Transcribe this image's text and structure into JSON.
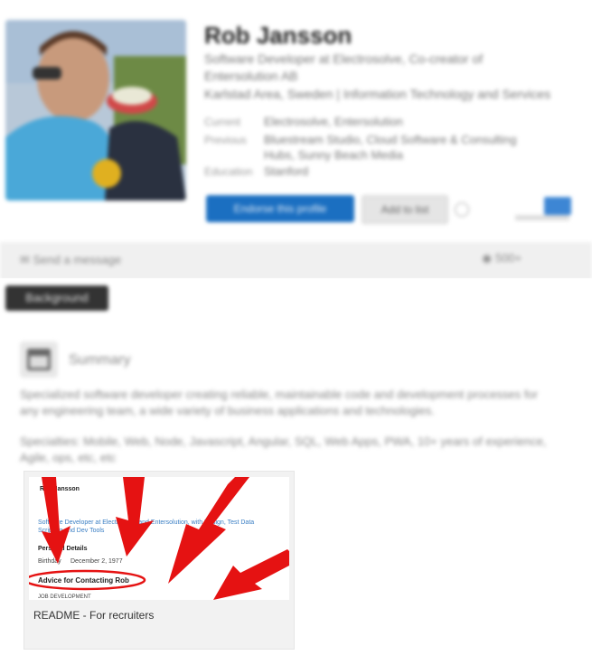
{
  "profile": {
    "name": "Rob Jansson",
    "headline_line1": "Software Developer at Electrosolve, Co-creator of",
    "headline_line2": "Entersolution AB",
    "headline_line3": "Karlstad Area, Sweden  |  Information Technology and Services",
    "fields": [
      {
        "label": "Current",
        "value": "Electrosolve, Entersolution"
      },
      {
        "label": "Previous",
        "value": "Bluestream Studio, Cloud Software & Consulting"
      },
      {
        "label": "",
        "value": "Hubs, Sunny Beach Media"
      },
      {
        "label": "Education",
        "value": "Stanford"
      }
    ],
    "primary_button": "Endorse this profile",
    "secondary_button": "Add to list",
    "badge": "in"
  },
  "bar": {
    "left_label": "Send a message",
    "right_label": "500+"
  },
  "section": {
    "tag": "Background",
    "summary_title": "Summary",
    "paragraph1": "Specialized software developer creating reliable, maintainable code and development processes for any engineering team, a wide variety of business applications and technologies.",
    "paragraph2": "Specialties: Mobile, Web, Node, Javascript, Angular, SQL, Web Apps, PWA, 10+ years of experience, Agile, ops, etc, etc"
  },
  "attachment": {
    "caption": "README - For recruiters",
    "thumb_header": "Rob Jansson",
    "thumb_link": "Software Developer at Electrosolve and Entersolution, with Design, Test Data Scripting and Dev Tools",
    "thumb_personal": "Personal Details",
    "thumb_birthday_label": "Birthday",
    "thumb_birthday_value": "December 2, 1977",
    "thumb_advice": "Advice for Contacting Rob",
    "thumb_footer": "JOB DEVELOPMENT"
  },
  "colors": {
    "primary": "#1b6fc1",
    "arrow": "#e51212",
    "tag_bg": "#333333"
  }
}
